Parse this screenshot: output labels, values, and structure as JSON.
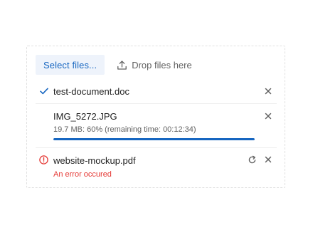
{
  "toolbar": {
    "select_label": "Select files...",
    "drop_label": "Drop files here",
    "drop_icon": "upload-icon"
  },
  "files": [
    {
      "name": "test-document.doc",
      "state": "uploaded",
      "status_icon": "check-icon",
      "actions": [
        "remove-icon"
      ]
    },
    {
      "name": "IMG_5272.JPG",
      "state": "uploading",
      "status": "19.7 MB: 60% (remaining time: 00:12:34)",
      "progress_fraction": 1.0,
      "actions": [
        "remove-icon"
      ]
    },
    {
      "name": "website-mockup.pdf",
      "state": "error",
      "status_icon": "error-icon",
      "error": "An error occured",
      "actions": [
        "retry-icon",
        "remove-icon"
      ]
    }
  ],
  "colors": {
    "accent": "#1565c0",
    "accent_bg": "#eef3fb",
    "error": "#e53935",
    "text": "#212121",
    "muted": "#616161",
    "border": "#e0e0e0"
  }
}
